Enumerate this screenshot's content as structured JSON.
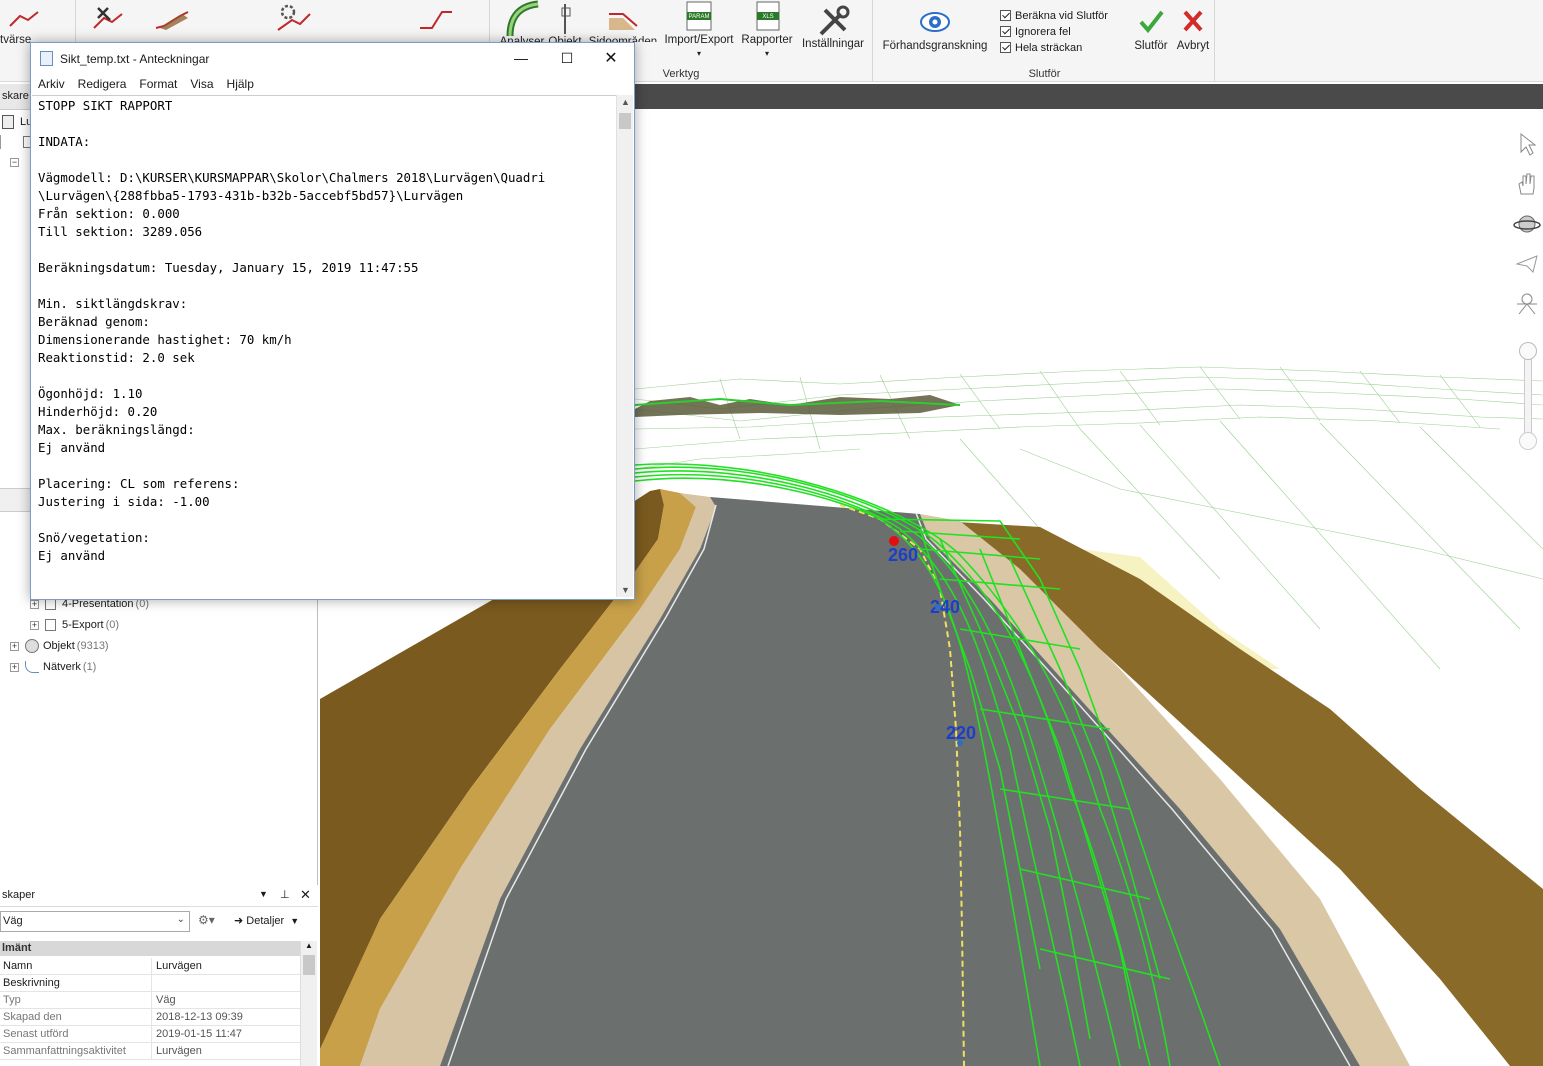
{
  "ribbon": {
    "left_partial_label": "tvärse",
    "verktyg": {
      "group_label": "Verktyg",
      "analyser": "Analyser",
      "objekt": "Objekt",
      "sidoomraden": "Sidoområden",
      "import_export": "Import/Export",
      "rapporter": "Rapporter",
      "installningar": "Inställningar",
      "param_tag": "PARAM",
      "xls_tag": "XLS"
    },
    "slutfor_group": {
      "group_label": "Slutför",
      "preview": "Förhandsgranskning",
      "checks": [
        {
          "label": "Beräkna vid Slutför",
          "checked": true
        },
        {
          "label": "Ignorera fel",
          "checked": true
        },
        {
          "label": "Hela sträckan",
          "checked": true
        }
      ],
      "finish": "Slutför",
      "cancel": "Avbryt"
    }
  },
  "left_panel": {
    "header_partial": "skare",
    "root_partial": "Lu",
    "tree": [
      {
        "label": "4-Presentation",
        "count": "(0)"
      },
      {
        "label": "5-Export",
        "count": "(0)"
      },
      {
        "label": "Objekt",
        "count": "(9313)"
      },
      {
        "label": "Nätverk",
        "count": "(1)"
      }
    ]
  },
  "properties": {
    "title_partial": "skaper",
    "combo_value": "Väg",
    "details_label": "Detaljer",
    "section_partial": "lmänt",
    "rows": [
      {
        "key": "Namn",
        "value": "Lurvägen"
      },
      {
        "key": "Beskrivning",
        "value": ""
      },
      {
        "key": "Typ",
        "value": "Väg"
      },
      {
        "key": "Skapad den",
        "value": "2018-12-13 09:39"
      },
      {
        "key": "Senast utförd",
        "value": "2019-01-15 11:47"
      },
      {
        "key": "Sammanfattningsaktivitet",
        "value": "Lurvägen"
      }
    ]
  },
  "notepad": {
    "title": "Sikt_temp.txt - Anteckningar",
    "menu": [
      "Arkiv",
      "Redigera",
      "Format",
      "Visa",
      "Hjälp"
    ],
    "lines": [
      "STOPP SIKT RAPPORT",
      "",
      "INDATA:",
      "",
      "Vägmodell: D:\\KURSER\\KURSMAPPAR\\Skolor\\Chalmers 2018\\Lurvägen\\Quadri",
      "\\Lurvägen\\{288fbba5-1793-431b-b32b-5accebf5bd57}\\Lurvägen",
      "Från sektion: 0.000",
      "Till sektion: 3289.056",
      "",
      "Beräkningsdatum: Tuesday, January 15, 2019 11:47:55",
      "",
      "Min. siktlängdskrav:",
      "Beräknad genom:",
      "Dimensionerande hastighet: 70 km/h",
      "Reaktionstid: 2.0 sek",
      "",
      "Ögonhöjd: 1.10",
      "Hinderhöjd: 0.20",
      "Max. beräkningslängd:",
      "Ej använd",
      "",
      "Placering: CL som referens:",
      "Justering i sida: -1.00",
      "",
      "Snö/vegetation:",
      "Ej använd"
    ]
  },
  "viewport": {
    "station_labels": [
      "260",
      "240",
      "220"
    ],
    "colors": {
      "road": "#6b6f6e",
      "shoulder": "#8a6a2a",
      "grass": "#3c8c28",
      "sight_lines": "#22e022",
      "labels": "#1d3fc8",
      "marker": "#e01010"
    }
  }
}
